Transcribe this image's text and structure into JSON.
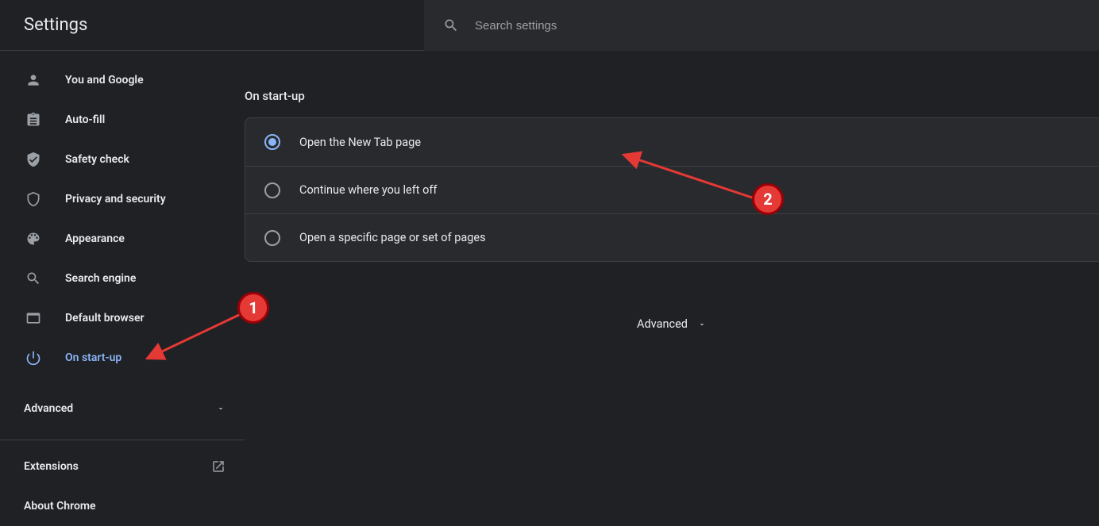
{
  "header": {
    "title": "Settings",
    "search_placeholder": "Search settings"
  },
  "sidebar": {
    "items": [
      {
        "label": "You and Google"
      },
      {
        "label": "Auto-fill"
      },
      {
        "label": "Safety check"
      },
      {
        "label": "Privacy and security"
      },
      {
        "label": "Appearance"
      },
      {
        "label": "Search engine"
      },
      {
        "label": "Default browser"
      },
      {
        "label": "On start-up"
      }
    ],
    "advanced": "Advanced",
    "extensions": "Extensions",
    "about": "About Chrome"
  },
  "main": {
    "section_title": "On start-up",
    "options": [
      {
        "label": "Open the New Tab page"
      },
      {
        "label": "Continue where you left off"
      },
      {
        "label": "Open a specific page or set of pages"
      }
    ],
    "advanced": "Advanced"
  },
  "annotations": {
    "one": "1",
    "two": "2"
  }
}
